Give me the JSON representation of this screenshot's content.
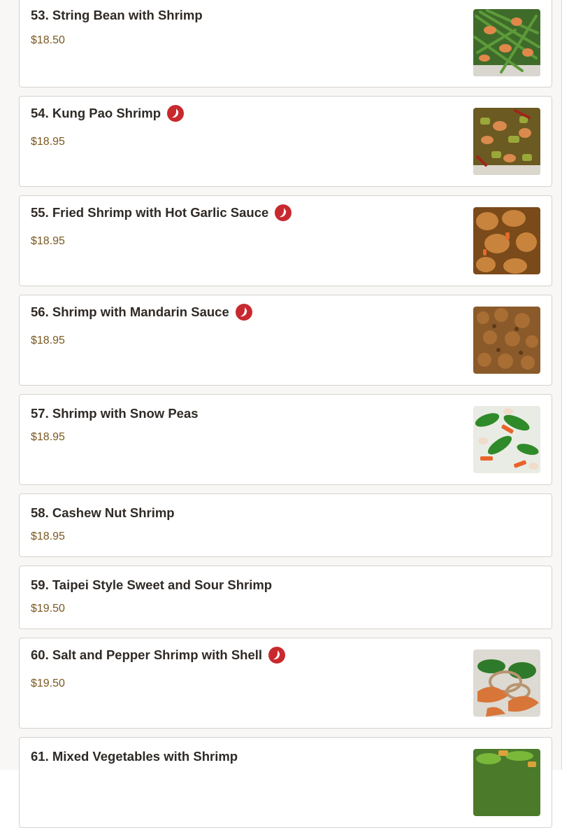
{
  "menu": {
    "items": [
      {
        "title": "53. String Bean with Shrimp",
        "price": "$18.50",
        "spicy": false,
        "image": "string-bean-shrimp-photo"
      },
      {
        "title": "54. Kung Pao Shrimp",
        "price": "$18.95",
        "spicy": true,
        "image": "kung-pao-shrimp-photo"
      },
      {
        "title": "55. Fried Shrimp with Hot Garlic Sauce",
        "price": "$18.95",
        "spicy": true,
        "image": "fried-shrimp-garlic-photo"
      },
      {
        "title": "56. Shrimp with Mandarin Sauce",
        "price": "$18.95",
        "spicy": true,
        "image": "shrimp-mandarin-photo"
      },
      {
        "title": "57. Shrimp with Snow Peas",
        "price": "$18.95",
        "spicy": false,
        "image": "shrimp-snow-peas-photo"
      },
      {
        "title": "58. Cashew Nut Shrimp",
        "price": "$18.95",
        "spicy": false,
        "image": null
      },
      {
        "title": "59. Taipei Style Sweet and Sour Shrimp",
        "price": "$19.50",
        "spicy": false,
        "image": null
      },
      {
        "title": "60. Salt and Pepper Shrimp with Shell",
        "price": "$19.50",
        "spicy": true,
        "image": "salt-pepper-shrimp-photo"
      },
      {
        "title": "61. Mixed Vegetables with Shrimp",
        "price": "",
        "spicy": false,
        "image": "mixed-vegetables-shrimp-photo"
      }
    ]
  },
  "icons": {
    "spicy": "chili-pepper-icon"
  },
  "colors": {
    "spicy_badge": "#c8292e",
    "price": "#7a5820",
    "card_border": "#d6d2ce"
  }
}
